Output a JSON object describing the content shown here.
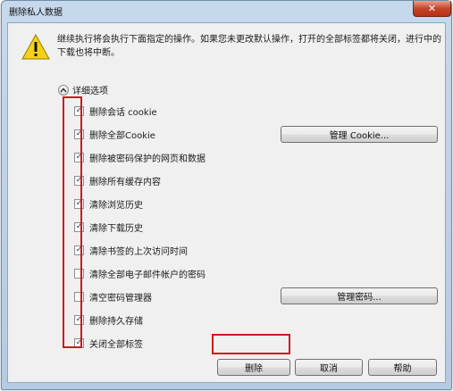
{
  "window": {
    "title": "删除私人数据",
    "close_glyph": "✕"
  },
  "message": "继续执行将会执行下面指定的操作。如果您未更改默认操作，打开的全部标签都将关闭，进行中的下载也将中断。",
  "details_toggle": {
    "label": "详细选项",
    "icon": "chevron-up-icon"
  },
  "options": [
    {
      "label": "删除会话 cookie",
      "checked": true
    },
    {
      "label": "删除全部Cookie",
      "checked": true
    },
    {
      "label": "删除被密码保护的网页和数据",
      "checked": true
    },
    {
      "label": "删除所有缓存内容",
      "checked": true
    },
    {
      "label": "清除浏览历史",
      "checked": true
    },
    {
      "label": "清除下载历史",
      "checked": true
    },
    {
      "label": "清除书签的上次访问时间",
      "checked": true
    },
    {
      "label": "清除全部电子邮件帐户的密码",
      "checked": false
    },
    {
      "label": "清空密码管理器",
      "checked": false
    },
    {
      "label": "删除持久存储",
      "checked": true
    },
    {
      "label": "关闭全部标签",
      "checked": true
    }
  ],
  "side_buttons": {
    "manage_cookie": "管理 Cookie...",
    "manage_passwords": "管理密码..."
  },
  "footer": {
    "delete": "删除",
    "cancel": "取消",
    "help": "帮助"
  },
  "colors": {
    "highlight": "#d0171d",
    "title_gradient": "#c6d9ec",
    "warning_yellow": "#f5d118"
  }
}
